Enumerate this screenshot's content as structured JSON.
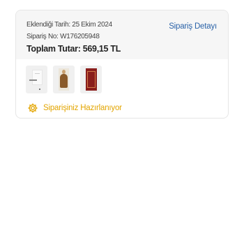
{
  "order": {
    "date_line": "Eklendiği Tarih: 25 Ekim 2024",
    "order_no_line": "Sipariş No: W176205948",
    "total_line": "Toplam Tutar: 569,15 TL",
    "detail_link": "Sipariş Detayı",
    "status_text": "Siparişiniz Hazırlanıyor",
    "status_color": "#e3a500",
    "status_icon": "gear-icon",
    "link_color": "#2b63a8"
  }
}
